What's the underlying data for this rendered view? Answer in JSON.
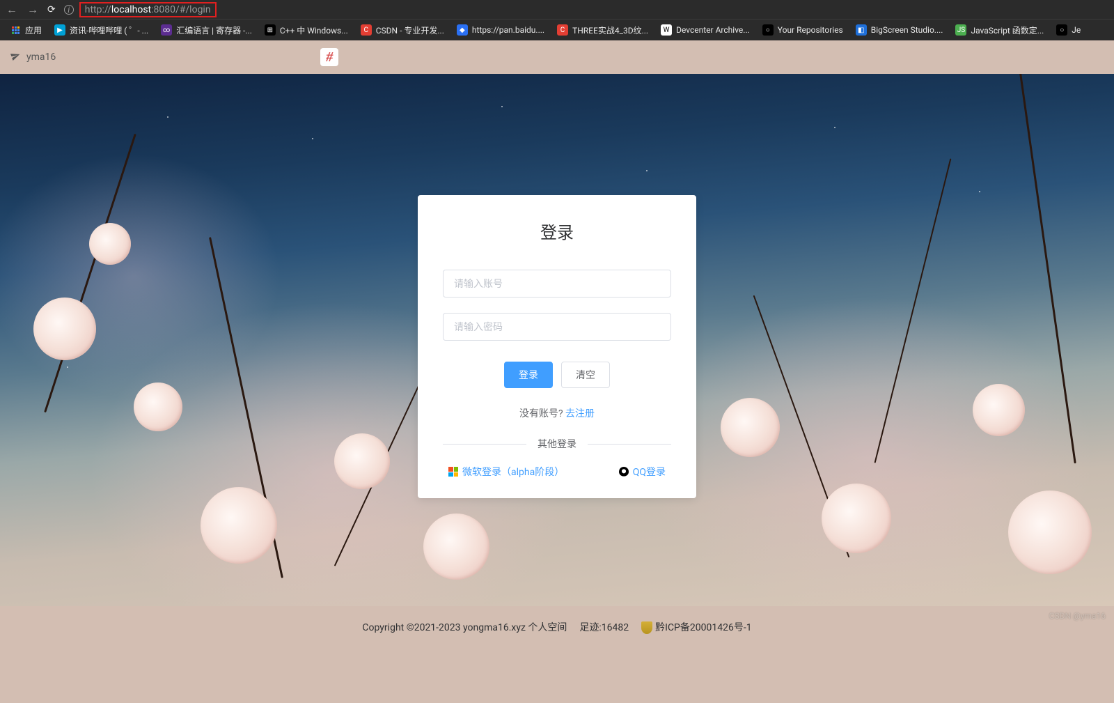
{
  "browser": {
    "url_prefix": "http://",
    "url_host": "localhost",
    "url_suffix": ":8080/#/login"
  },
  "bookmarks": {
    "apps": "应用",
    "items": [
      {
        "label": "资讯-哔哩哔哩 ( ゜- ...",
        "icon_bg": "#00a1d6",
        "icon_txt": "▶"
      },
      {
        "label": "汇编语言 | 寄存器 -...",
        "icon_bg": "#5c2d91",
        "icon_txt": "∞"
      },
      {
        "label": "C++ 中 Windows...",
        "icon_bg": "#000",
        "icon_txt": "⊞"
      },
      {
        "label": "CSDN - 专业开发...",
        "icon_bg": "#e33e33",
        "icon_txt": "C"
      },
      {
        "label": "https://pan.baidu....",
        "icon_bg": "#2a70f4",
        "icon_txt": "◆"
      },
      {
        "label": "THREE实战4_3D纹...",
        "icon_bg": "#e33e33",
        "icon_txt": "C"
      },
      {
        "label": "Devcenter Archive...",
        "icon_bg": "#fff",
        "icon_txt": "W"
      },
      {
        "label": "Your Repositories",
        "icon_bg": "#000",
        "icon_txt": "○"
      },
      {
        "label": "BigScreen Studio....",
        "icon_bg": "#1e6fd9",
        "icon_txt": "◧"
      },
      {
        "label": "JavaScript 函数定...",
        "icon_bg": "#4caf50",
        "icon_txt": "JS"
      },
      {
        "label": "Je",
        "icon_bg": "#000",
        "icon_txt": "○"
      }
    ]
  },
  "header": {
    "brand": "yma16",
    "hash": "#"
  },
  "login": {
    "title": "登录",
    "username_placeholder": "请输入账号",
    "password_placeholder": "请输入密码",
    "submit": "登录",
    "clear": "清空",
    "no_account": "没有账号? ",
    "register": "去注册",
    "other_title": "其他登录",
    "ms_login": "微软登录（alpha阶段）",
    "qq_login": "QQ登录"
  },
  "footer": {
    "copyright": "Copyright ©2021-2023 yongma16.xyz 个人空间",
    "visits": "足迹:16482",
    "icp": "黔ICP备20001426号-1"
  },
  "watermark": "CSDN @yma16"
}
